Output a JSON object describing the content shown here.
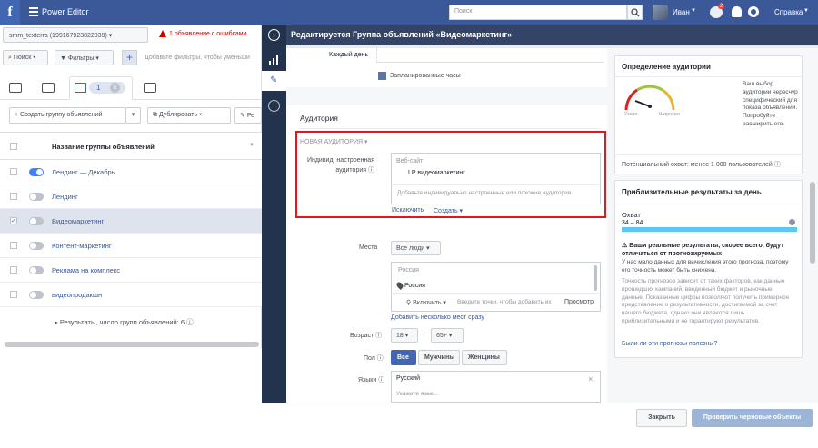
{
  "topbar": {
    "logo": "f",
    "app_title": "Power Editor",
    "search_placeholder": "Поиск",
    "user_name": "Иван",
    "notif_count": "2",
    "help_label": "Справка"
  },
  "left": {
    "account": "smm_texterra (199167923822039)",
    "error_text": "1 объявление с ошибками",
    "search_label": "Поиск",
    "filter_label": "Фильтры",
    "filter_hint": "Добавьте фильтры, чтобы уменьши",
    "tab_count": "1",
    "create_label": "Создать группу объявлений",
    "duplicate_label": "Дублировать",
    "edit_label": "Ре",
    "col_name": "Название группы объявлений",
    "rows": [
      {
        "name": "Лендинг — Декабрь",
        "on": true,
        "checked": false
      },
      {
        "name": "Лендинг",
        "on": false,
        "checked": false
      },
      {
        "name": "Видеомаркетинг",
        "on": false,
        "checked": true
      },
      {
        "name": "Контент-маркетинг",
        "on": false,
        "checked": false
      },
      {
        "name": "Реклама на комплекс",
        "on": false,
        "checked": false
      },
      {
        "name": "видеопродакшн",
        "on": false,
        "checked": false
      }
    ],
    "summary": "Результаты, число групп объявлений: 6"
  },
  "editor": {
    "title": "Редактируется Группа объявлений «Видеомаркетинг»",
    "schedule_label": "Каждый день",
    "legend": "Запланированные часы",
    "audience_title": "Аудитория",
    "new_audience": "НОВАЯ АУДИТОРИЯ",
    "custom_label": "Индивид. настроенная аудитория",
    "website_label": "Веб-сайт",
    "lp_value": "LP видеомаркетинг",
    "custom_placeholder": "Добавьте индивидуально настроенные или похожие аудитории",
    "exclude_link": "Исключить",
    "create_link": "Создать",
    "places_label": "Места",
    "people_select": "Все люди",
    "loc_title": "Россия",
    "loc_value": "Россия",
    "include_select": "Включить",
    "loc_placeholder": "Введите точки, чтобы добавить их",
    "browse": "Просмотр",
    "add_multi": "Добавить несколько мест сразу",
    "age_label": "Возраст",
    "age_min": "18",
    "age_max": "65+",
    "gender_label": "Пол",
    "gender_all": "Все",
    "gender_m": "Мужчины",
    "gender_f": "Женщины",
    "lang_label": "Языки",
    "lang_value": "Русский",
    "lang_placeholder": "Укажите язык..."
  },
  "definition": {
    "title": "Определение аудитории",
    "narrow": "Узкая",
    "wide": "Широкая",
    "text": "Ваш выбор аудитории чересчур специфический для показа объявлений. Попробуйте расширить его.",
    "reach": "Потенциальный охват: менее 1 000 пользователей"
  },
  "estimates": {
    "title": "Приблизительные результаты за день",
    "reach_label": "Охват",
    "reach_range": "34 – 84",
    "warn_title": "Ваши реальные результаты, скорее всего, будут отличаться от прогнозируемых",
    "warn_body": "У нас мало данных для вычисления этого прогноза, поэтому его точность может быть снижена.",
    "warn_body2": "Точность прогнозов зависит от таких факторов, как данные прошедших кампаний, введенный бюджет и рыночные данные. Показанные цифры позволяют получить примерное представление о результативности, достигаемой за счет вашего бюджета, однако они являются лишь приблизительными и не гарантируют результатов.",
    "useful_link": "Были ли эти прогнозы полезны?"
  },
  "footer": {
    "close": "Закрыть",
    "check": "Проверить черновые объекты"
  }
}
